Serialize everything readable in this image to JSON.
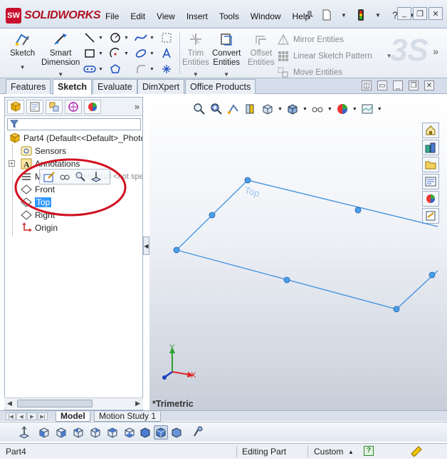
{
  "app": {
    "brand": "SOLIDWORKS",
    "logo_mark": "SW",
    "colors": {
      "brand": "#c8102e",
      "sketch_line": "#3d8fe0",
      "selection": "#3399ff",
      "callout": "#d01020"
    }
  },
  "menu": [
    "File",
    "Edit",
    "View",
    "Insert",
    "Tools",
    "Window",
    "Help"
  ],
  "window_controls": [
    "pin-icon",
    "minimize-icon",
    "restore-icon",
    "close-icon"
  ],
  "ribbon": {
    "sketch": "Sketch",
    "smart_dimension_1": "Smart",
    "smart_dimension_2": "Dimension",
    "trim_1": "Trim",
    "trim_2": "Entities",
    "convert_1": "Convert",
    "convert_2": "Entities",
    "offset_1": "Offset",
    "offset_2": "Entities",
    "mirror": "Mirror Entities",
    "linear_pattern": "Linear Sketch Pattern",
    "move": "Move Entities",
    "more": "»"
  },
  "tabs": [
    "Features",
    "Sketch",
    "Evaluate",
    "DimXpert",
    "Office Products"
  ],
  "tree": {
    "root": "Part4  (Default<<Default>_Photo",
    "items": [
      "Sensors",
      "Annotations",
      "Material <not specified>",
      "Front",
      "Top",
      "Right",
      "Origin"
    ],
    "partial_items": [
      "M",
      "Right"
    ]
  },
  "panel_more": "»",
  "graphics": {
    "plane_label": "Top",
    "view_label": "*Trimetric",
    "triad_x": "X",
    "triad_y": "Y"
  },
  "model_tabs": [
    "Model",
    "Motion Study 1"
  ],
  "status": {
    "doc": "Part4",
    "mode": "Editing Part",
    "units": "Custom",
    "units_arrow": "▲",
    "help": "?"
  }
}
